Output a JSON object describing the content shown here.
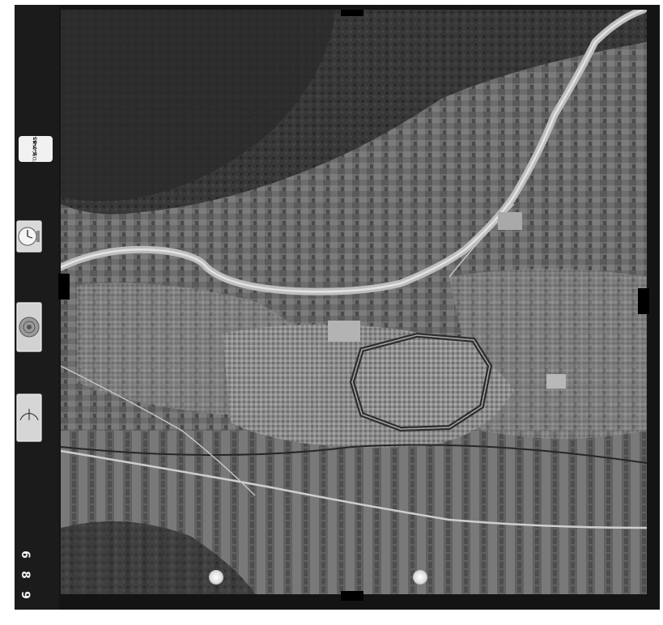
{
  "photo": {
    "frame_number": [
      "6",
      "8",
      "9"
    ],
    "data_label": {
      "line1": "8-7-85",
      "line2": "TOSCANA"
    },
    "instruments": [
      "clock-icon",
      "altimeter-icon",
      "level-icon"
    ]
  },
  "colors": {
    "frame": "#141414",
    "river": "#bdbdbd",
    "city": "#8c8c8c",
    "forest": "#2f2f2f",
    "fields": "#6a6a6a"
  }
}
